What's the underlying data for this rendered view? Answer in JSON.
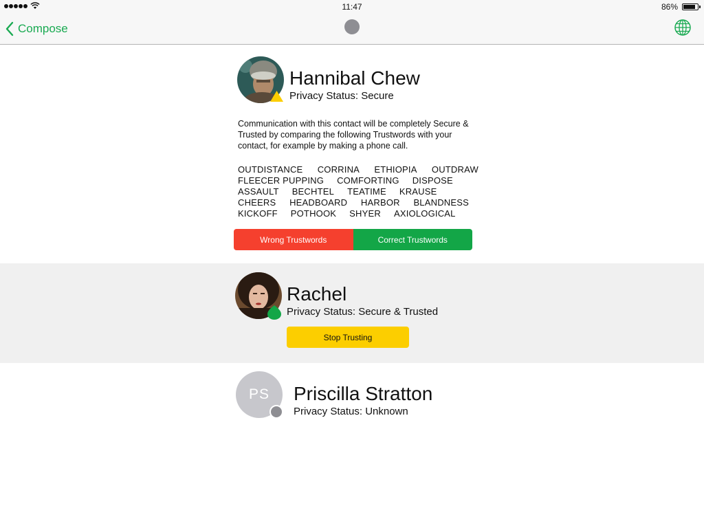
{
  "status_bar": {
    "time": "11:47",
    "battery_percent": "86%",
    "battery_level": 0.86
  },
  "nav": {
    "back_label": "Compose",
    "back_icon": "chevron-left-icon",
    "center_icon": "privacy-status-dot",
    "right_icon": "globe-icon"
  },
  "colors": {
    "accent": "#1aaa52",
    "danger": "#f5402e",
    "success": "#13a647",
    "warning": "#fcce00",
    "gray": "#8e8e93"
  },
  "contacts": [
    {
      "name": "Hannibal Chew",
      "privacy_status": "Privacy Status: Secure",
      "badge": "yellow-warning-triangle",
      "info": "Communication with this contact will be completely Secure & Trusted by comparing the following Trustwords with your contact, for example by making a phone call.",
      "trustwords": [
        [
          "OUTDISTANCE",
          "CORRINA",
          "ETHIOPIA",
          "OUTDRAW"
        ],
        [
          "FLEECER PUPPING",
          "COMFORTING",
          "DISPOSE"
        ],
        [
          "ASSAULT",
          "BECHTEL",
          "TEATIME",
          "KRAUSE"
        ],
        [
          "CHEERS",
          "HEADBOARD",
          "HARBOR",
          "BLANDNESS"
        ],
        [
          "KICKOFF",
          "POTHOOK",
          "SHYER",
          "AXIOLOGICAL"
        ]
      ],
      "wrong_label": "Wrong Trustwords",
      "correct_label": "Correct Trustwords"
    },
    {
      "name": "Rachel",
      "privacy_status": "Privacy Status: Secure & Trusted",
      "badge": "green-shield",
      "stop_label": "Stop Trusting"
    },
    {
      "name": "Priscilla Stratton",
      "privacy_status": "Privacy Status: Unknown",
      "initials": "PS",
      "badge": "gray-dot"
    }
  ]
}
